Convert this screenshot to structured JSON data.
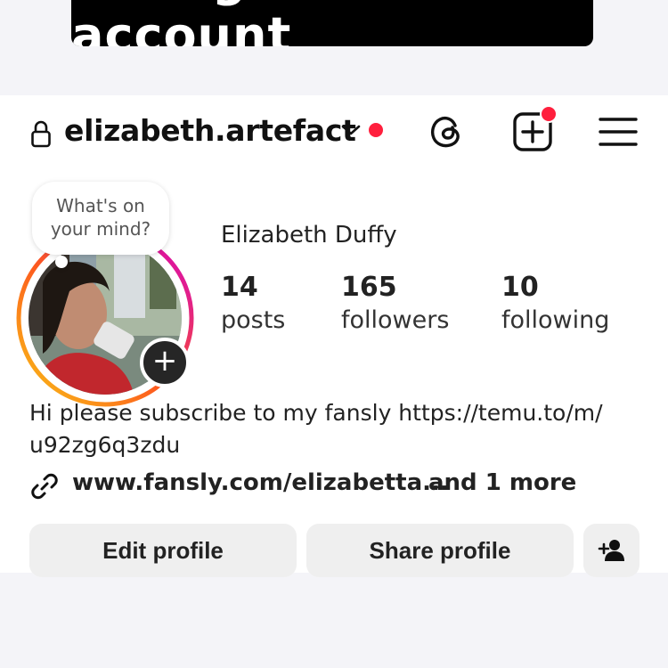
{
  "caption": "Instagram account",
  "header": {
    "username": "elizabeth.artefact"
  },
  "profile": {
    "note_bubble": [
      "What's on",
      "your mind?"
    ],
    "display_name": "Elizabeth Duffy",
    "stats": [
      {
        "value": "14",
        "label": "posts"
      },
      {
        "value": "165",
        "label": "followers"
      },
      {
        "value": "10",
        "label": "following"
      }
    ],
    "bio_line1": "Hi please subscribe to my fansly https://temu.to/m/",
    "bio_line2": "u92zg6q3zdu",
    "link_text": "www.fansly.com/elizabetta...",
    "link_more": "and 1 more"
  },
  "actions": {
    "edit_label": "Edit profile",
    "share_label": "Share profile"
  },
  "icons": {
    "lock": "lock-icon",
    "chevron": "chevron-down-icon",
    "threads": "threads-icon",
    "new_post": "plus-square-icon",
    "menu": "hamburger-menu-icon",
    "link": "link-icon",
    "add_story": "plus-icon",
    "discover_people": "add-person-icon"
  },
  "colors": {
    "notification": "#ff1f3d",
    "story_ring_start": "#f9c516",
    "story_ring_end": "#d300c5",
    "button_bg": "#efefef"
  }
}
